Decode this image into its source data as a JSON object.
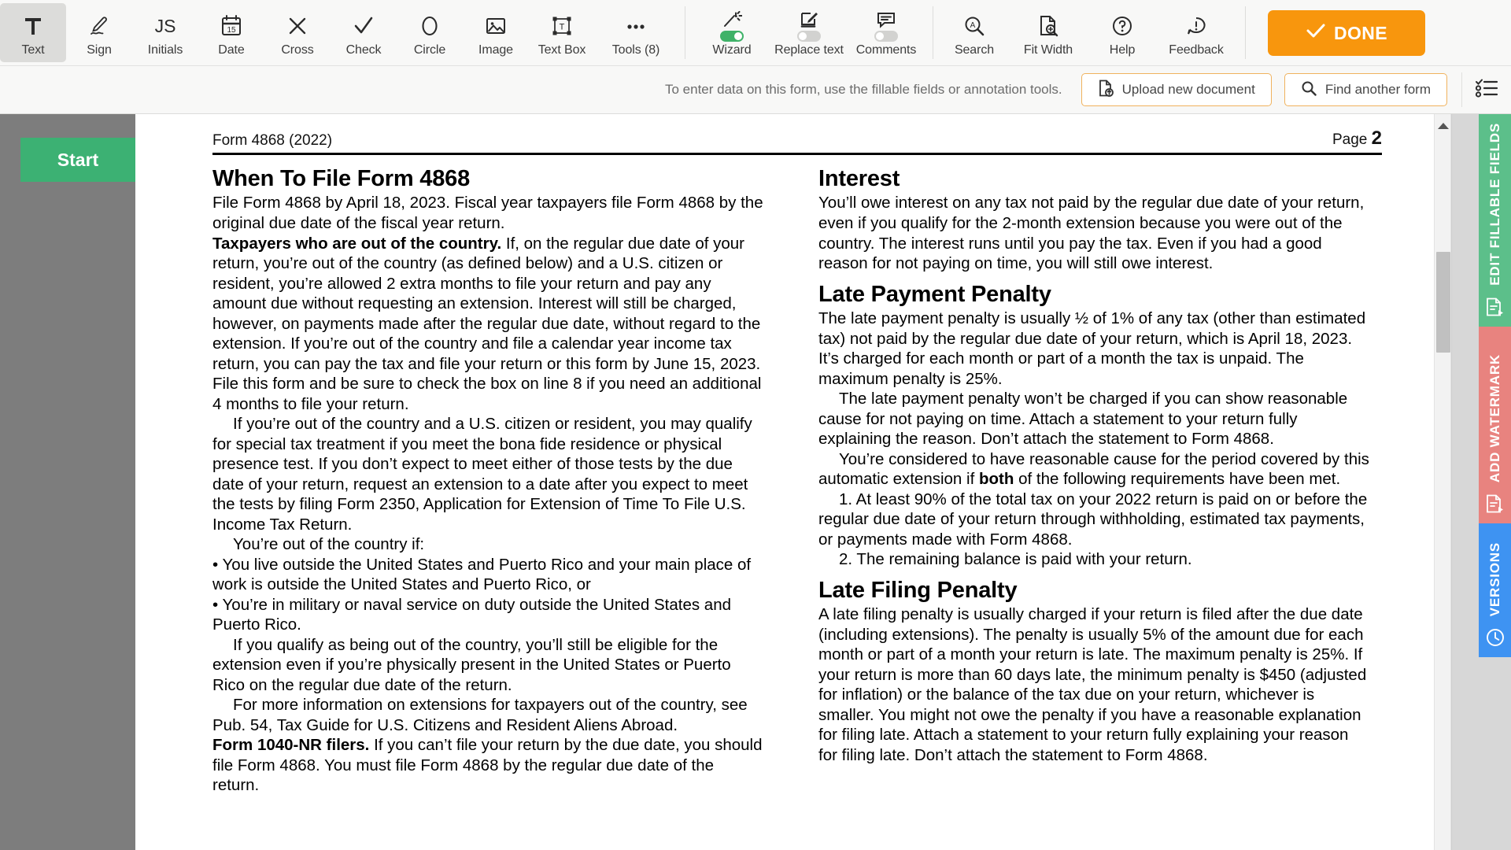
{
  "toolbar": {
    "tools": [
      {
        "name": "text",
        "label": "Text",
        "icon": "text-tool-icon",
        "active": true
      },
      {
        "name": "sign",
        "label": "Sign",
        "icon": "signature-icon",
        "active": false
      },
      {
        "name": "initials",
        "label": "Initials",
        "icon": "initials-icon",
        "active": false
      },
      {
        "name": "date",
        "label": "Date",
        "icon": "calendar-icon",
        "active": false
      },
      {
        "name": "cross",
        "label": "Cross",
        "icon": "cross-icon",
        "active": false
      },
      {
        "name": "check",
        "label": "Check",
        "icon": "check-icon",
        "active": false
      },
      {
        "name": "circle",
        "label": "Circle",
        "icon": "circle-icon",
        "active": false
      },
      {
        "name": "image",
        "label": "Image",
        "icon": "image-icon",
        "active": false
      },
      {
        "name": "textbox",
        "label": "Text Box",
        "icon": "text-box-icon",
        "active": false
      },
      {
        "name": "tools",
        "label": "Tools (8)",
        "icon": "ellipsis-icon",
        "active": false
      }
    ],
    "toggles": [
      {
        "name": "wizard",
        "label": "Wizard",
        "icon": "magic-wand-icon",
        "on": true
      },
      {
        "name": "replace-text",
        "label": "Replace text",
        "icon": "replace-text-icon",
        "on": false
      },
      {
        "name": "comments",
        "label": "Comments",
        "icon": "comment-icon",
        "on": false
      }
    ],
    "actions": [
      {
        "name": "search",
        "label": "Search",
        "icon": "search-icon"
      },
      {
        "name": "fit-width",
        "label": "Fit Width",
        "icon": "fit-width-icon"
      },
      {
        "name": "help",
        "label": "Help",
        "icon": "question-circle-icon"
      },
      {
        "name": "feedback",
        "label": "Feedback",
        "icon": "feedback-icon"
      }
    ],
    "done_label": "DONE",
    "done_color": "#f8960d"
  },
  "subbar": {
    "message": "To enter data on this form, use the fillable fields or annotation tools.",
    "upload_label": "Upload new document",
    "find_label": "Find another form"
  },
  "left_rail": {
    "start_label": "Start",
    "start_color": "#3cb173"
  },
  "document": {
    "header_left": "Form 4868 (2022)",
    "header_right_label": "Page",
    "header_right_value": "2",
    "left_column": {
      "heading": "When To File Form 4868",
      "paragraphs": [
        {
          "text": "File Form 4868 by April 18, 2023. Fiscal year taxpayers file Form 4868 by the original due date of the fiscal year return."
        },
        {
          "lead": "Taxpayers who are out of the country.",
          "text": " If, on the regular due date of your return, you’re out of the country (as defined below) and a U.S. citizen or resident, you’re allowed 2 extra months to file your return and pay any amount due without requesting an extension. Interest will still be charged, however, on payments made after the regular due date, without regard to the extension. If you’re out of the country and file a calendar year income tax return, you can pay the tax and file your return or this form by June 15, 2023. File this form and be sure to check the box on line 8 if you need an additional 4 months to file your return."
        },
        {
          "indent": true,
          "text": "If you’re out of the country and a U.S. citizen or resident, you may qualify for special tax treatment if you meet the bona fide residence or physical presence test. If you don’t expect to meet either of those tests by the due date of your return, request an extension to a date after you expect to meet the tests by filing Form 2350, Application for Extension of Time To File U.S. Income Tax Return."
        },
        {
          "indent": true,
          "text": "You’re out of the country if:"
        },
        {
          "text": "• You live outside the United States and Puerto Rico and your main place of work is outside the United States and Puerto Rico, or"
        },
        {
          "text": "• You’re in military or naval service on duty outside the United States and Puerto Rico."
        },
        {
          "indent": true,
          "text": "If you qualify as being out of the country, you’ll still be eligible for the extension even if you’re physically present in the United States or Puerto Rico on the regular due date of the return."
        },
        {
          "indent": true,
          "text": "For more information on extensions for taxpayers out of the country, see Pub. 54, Tax Guide for U.S. Citizens and Resident Aliens Abroad."
        },
        {
          "lead": "Form 1040-NR filers.",
          "text": " If you can’t file your return by the due date, you should file Form 4868. You must file Form 4868 by the regular due date of the return."
        }
      ]
    },
    "right_column": {
      "sections": [
        {
          "heading": "Interest",
          "paragraphs": [
            {
              "text": "You’ll owe interest on any tax not paid by the regular due date of your return, even if you qualify for the 2-month extension because you were out of the country. The interest runs until you pay the tax. Even if you had a good reason for not paying on time, you will still owe interest."
            }
          ]
        },
        {
          "heading": "Late Payment Penalty",
          "paragraphs": [
            {
              "text": "The late payment penalty is usually ½ of 1% of any tax (other than estimated tax) not paid by the regular due date of your return, which is April 18, 2023. It’s charged for each month or part of a month the tax is unpaid. The maximum penalty is 25%."
            },
            {
              "indent": true,
              "text": "The late payment penalty won’t be charged if you can show reasonable cause for not paying on time. Attach a statement to your return fully explaining the reason. Don’t attach the statement to Form 4868."
            },
            {
              "indent": true,
              "pre": "You’re considered to have reasonable cause for the period covered by this automatic extension if ",
              "bold": "both",
              "post": " of the following requirements have been met."
            },
            {
              "indent": true,
              "text": "1. At least 90% of the total tax on your 2022 return is paid on or before the regular due date of your return through withholding, estimated tax payments, or payments made with Form 4868."
            },
            {
              "indent": true,
              "text": "2. The remaining balance is paid with your return."
            }
          ]
        },
        {
          "heading": "Late Filing Penalty",
          "paragraphs": [
            {
              "text": "A late filing penalty is usually charged if your return is filed after the due date (including extensions). The penalty is usually 5% of the amount due for each month or part of a month your return is late. The maximum penalty is 25%. If your return is more than 60 days late, the minimum penalty is $450 (adjusted for inflation) or the balance of the tax due on your return, whichever is smaller. You might not owe the penalty if you have a reasonable explanation for filing late. Attach a statement to your return fully explaining your reason for filing late. Don’t attach the statement to Form 4868."
            }
          ]
        }
      ]
    }
  },
  "right_tabs": [
    {
      "name": "edit-fillable-fields",
      "label": "EDIT FILLABLE FIELDS",
      "icon": "fillable-fields-icon",
      "color": "#5cbf8a"
    },
    {
      "name": "add-watermark",
      "label": "ADD WATERMARK",
      "icon": "watermark-icon",
      "color": "#e8837f"
    },
    {
      "name": "versions",
      "label": "VERSIONS",
      "icon": "history-clock-icon",
      "color": "#3e93f2"
    }
  ]
}
